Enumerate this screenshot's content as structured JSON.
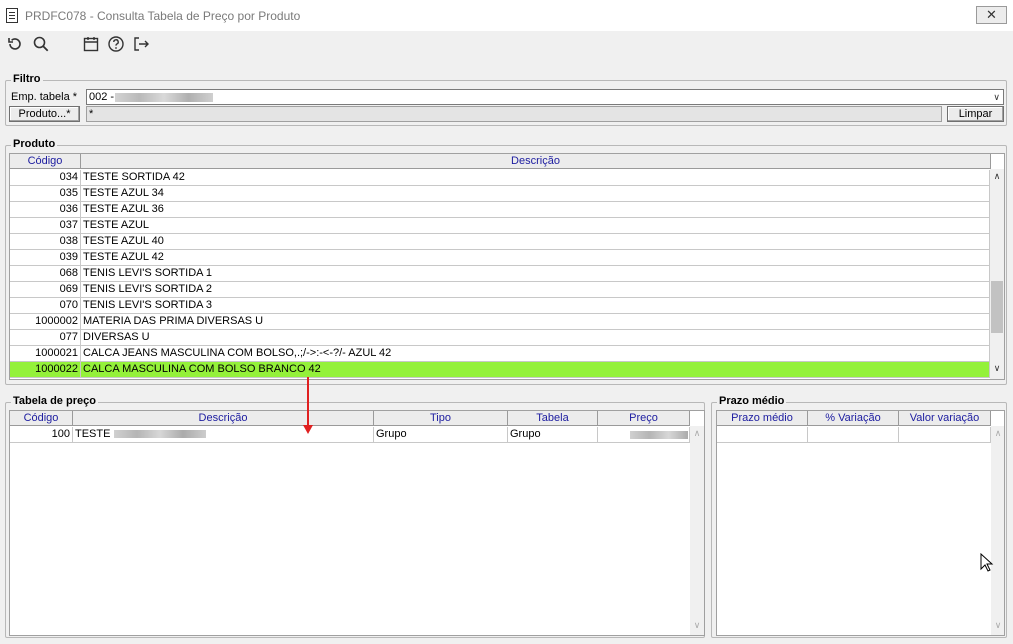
{
  "window": {
    "title": "PRDFC078 - Consulta Tabela de Preço por Produto",
    "close_label": "✕"
  },
  "toolbar": {
    "icons": [
      "refresh-icon",
      "search-icon",
      "calendar-icon",
      "help-icon",
      "exit-icon"
    ]
  },
  "filtro": {
    "label": "Filtro",
    "emp_tabela_label": "Emp. tabela *",
    "emp_tabela_value": "002 -",
    "produto_button": "Produto...*",
    "produto_value": "*",
    "limpar_button": "Limpar"
  },
  "produto": {
    "label": "Produto",
    "columns": [
      "Código",
      "Descrição"
    ],
    "rows": [
      {
        "codigo": "034",
        "descricao": "TESTE SORTIDA 42"
      },
      {
        "codigo": "035",
        "descricao": "TESTE AZUL 34"
      },
      {
        "codigo": "036",
        "descricao": "TESTE AZUL 36"
      },
      {
        "codigo": "037",
        "descricao": "TESTE AZUL"
      },
      {
        "codigo": "038",
        "descricao": "TESTE AZUL 40"
      },
      {
        "codigo": "039",
        "descricao": "TESTE AZUL 42"
      },
      {
        "codigo": "068",
        "descricao": "TENIS LEVI'S SORTIDA 1"
      },
      {
        "codigo": "069",
        "descricao": "TENIS LEVI'S SORTIDA 2"
      },
      {
        "codigo": "070",
        "descricao": "TENIS LEVI'S SORTIDA 3"
      },
      {
        "codigo": "1000002",
        "descricao": "MATERIA DAS PRIMA DIVERSAS U"
      },
      {
        "codigo": "077",
        "descricao": " DIVERSAS U"
      },
      {
        "codigo": "1000021",
        "descricao": "CALCA JEANS MASCULINA COM BOLSO,.;/->:-<-?/- AZUL 42"
      },
      {
        "codigo": "1000022",
        "descricao": "CALCA MASCULINA COM BOLSO BRANCO 42",
        "selected": true
      }
    ],
    "selected_color": "#94f13a"
  },
  "tabela_preco": {
    "label": "Tabela de preço",
    "columns": [
      "Código",
      "Descrição",
      "Tipo",
      "Tabela",
      "Preço"
    ],
    "rows": [
      {
        "codigo": "100",
        "descricao": "TESTE",
        "tipo": "Grupo",
        "tabela": "Grupo"
      }
    ]
  },
  "prazo_medio": {
    "label": "Prazo médio",
    "columns": [
      "Prazo médio",
      "% Variação",
      "Valor variação"
    ]
  }
}
